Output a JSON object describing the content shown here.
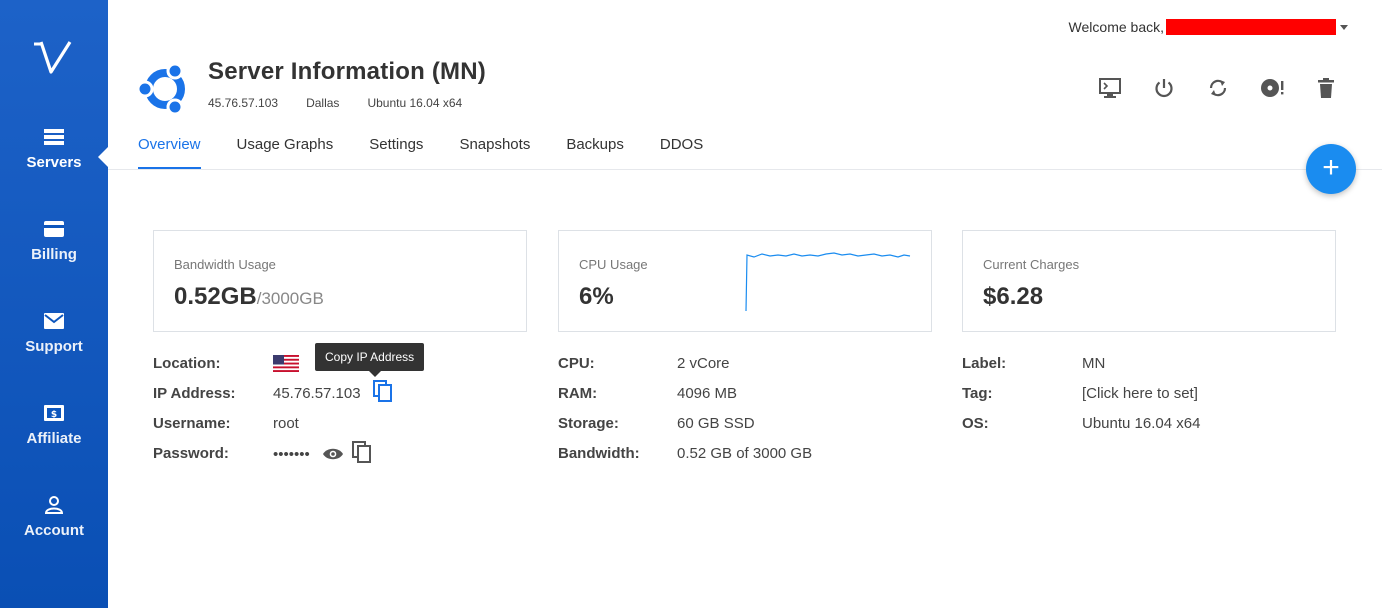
{
  "colors": {
    "sidebar": "#0a4fb4",
    "accent": "#1a73e8",
    "fab": "#1a8cf0",
    "redaction": "#ff0000"
  },
  "sidebar": {
    "logo_icon": "vultr-logo",
    "items": [
      {
        "label": "Servers",
        "icon": "servers-icon",
        "active": true
      },
      {
        "label": "Billing",
        "icon": "credit-card-icon"
      },
      {
        "label": "Support",
        "icon": "envelope-icon"
      },
      {
        "label": "Affiliate",
        "icon": "dollar-bill-icon"
      },
      {
        "label": "Account",
        "icon": "user-icon"
      }
    ]
  },
  "header": {
    "welcome": "Welcome back,",
    "title": "Server Information (MN)",
    "ip": "45.76.57.103",
    "location": "Dallas",
    "os": "Ubuntu 16.04 x64",
    "actions": [
      "console-icon",
      "power-icon",
      "restart-icon",
      "reinstall-icon",
      "trash-icon"
    ]
  },
  "tabs": [
    "Overview",
    "Usage Graphs",
    "Settings",
    "Snapshots",
    "Backups",
    "DDOS"
  ],
  "fab": {
    "label": "+"
  },
  "cards": {
    "bandwidth": {
      "label": "Bandwidth Usage",
      "value": "0.52GB",
      "suffix": "/3000GB"
    },
    "cpu": {
      "label": "CPU Usage",
      "value": "6%"
    },
    "charges": {
      "label": "Current Charges",
      "value": "$6.28"
    }
  },
  "details": {
    "left": {
      "location_label": "Location:",
      "ip_label": "IP Address:",
      "ip_value": "45.76.57.103",
      "username_label": "Username:",
      "username_value": "root",
      "password_label": "Password:",
      "password_value": "•••••••",
      "tooltip": "Copy IP Address"
    },
    "middle": {
      "cpu_label": "CPU:",
      "cpu_value": "2 vCore",
      "ram_label": "RAM:",
      "ram_value": "4096 MB",
      "storage_label": "Storage:",
      "storage_value": "60 GB SSD",
      "bandwidth_label": "Bandwidth:",
      "bandwidth_value": "0.52 GB of 3000 GB"
    },
    "right": {
      "label_label": "Label:",
      "label_value": "MN",
      "tag_label": "Tag:",
      "tag_value": "[Click here to set]",
      "os_label": "OS:",
      "os_value": "Ubuntu 16.04 x64"
    }
  }
}
